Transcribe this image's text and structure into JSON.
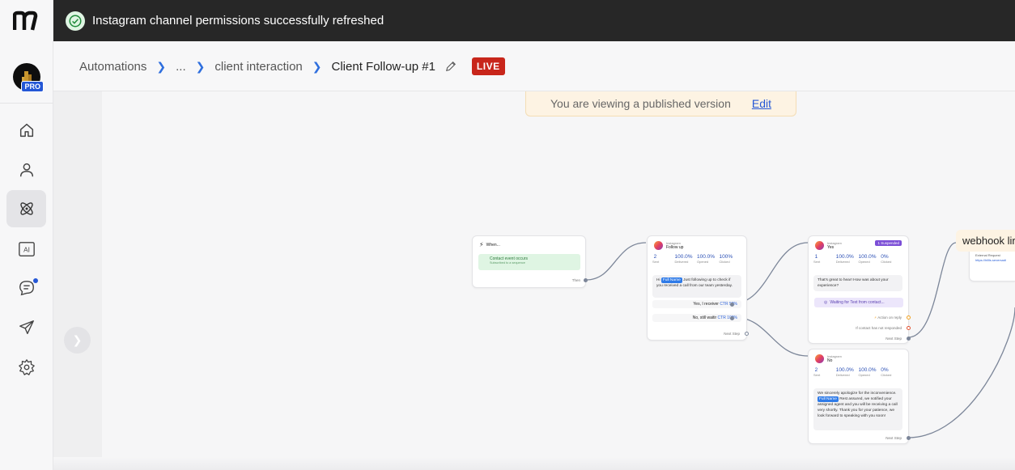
{
  "toast": {
    "message": "Instagram channel permissions successfully refreshed"
  },
  "sidebar": {
    "badge": "PRO",
    "ai_label": "AI"
  },
  "breadcrumb": {
    "items": [
      "Automations",
      "...",
      "client interaction"
    ],
    "current": "Client Follow-up #1",
    "status": "LIVE"
  },
  "banner": {
    "text": "You are viewing a published version",
    "edit_link": "Edit"
  },
  "flow": {
    "trigger": {
      "header": "When...",
      "event": "Contact event occurs",
      "sub": "Subscribed to a sequence",
      "then_label": "Then"
    },
    "followup": {
      "channel": "Instagram",
      "title": "Follow up",
      "stats": [
        {
          "value": "2",
          "label": "Sent"
        },
        {
          "value": "100.0%",
          "label": "Delivered"
        },
        {
          "value": "100.0%",
          "label": "Opened"
        },
        {
          "value": "100%",
          "label": "Clicked"
        }
      ],
      "message_pre": "Hi",
      "pill": "Full Name",
      "message_post": "Just following up to check if you received a call from our team yesterday.",
      "reply_yes": "Yes, I receiver",
      "reply_yes_ctr": "CTR 50%",
      "reply_no": "No, still waitir",
      "reply_no_ctr": "CTR 100%",
      "next_step": "Next Step"
    },
    "yes_node": {
      "channel": "Instagram",
      "title": "Yes",
      "badge": "1 Suspended",
      "stats": [
        {
          "value": "1",
          "label": "Sent"
        },
        {
          "value": "100.0%",
          "label": "Delivered"
        },
        {
          "value": "100.0%",
          "label": "Opened"
        },
        {
          "value": "0%",
          "label": "Clicked"
        }
      ],
      "message": "That's great to hear! How was about your experience?",
      "waiting": "Waiting for Text from contact...",
      "action_reply": "Action on reply",
      "not_responded": "If contact has not responded",
      "next_step": "Next Step"
    },
    "no_node": {
      "channel": "Instagram",
      "title": "No",
      "stats": [
        {
          "value": "2",
          "label": "Sent"
        },
        {
          "value": "100.0%",
          "label": "Delivered"
        },
        {
          "value": "100.0%",
          "label": "Opened"
        },
        {
          "value": "0%",
          "label": "Clicked"
        }
      ],
      "message_pre": "We sincerely apologize for the inconvenience.",
      "pill": "Full Name",
      "message_post": "Rest assured, we notified your assigned agent and you will be receiving a call very shortly. Thank you for your patience, we look forward to speaking with you soon!",
      "next_step": "Next Step"
    },
    "webhook": {
      "label": "webhook lir",
      "sub": "External Request",
      "url": "https://hillls.seversadi"
    }
  }
}
